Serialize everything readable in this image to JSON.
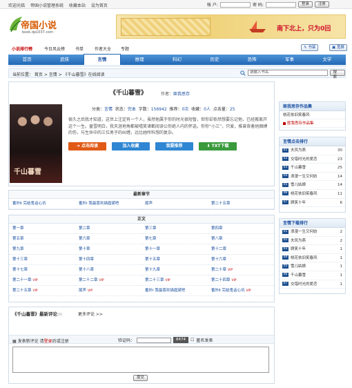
{
  "topbar": {
    "links": [
      "欢迎光临",
      "帝国小说管理系统",
      "收藏本站",
      "设为首页"
    ],
    "user_label": "帐 户:",
    "pass_label": "密 码:",
    "login_btn": "登录",
    "register_btn": "注册"
  },
  "logo": {
    "name": "帝国小说",
    "domain": "book.dp1037.com"
  },
  "banner": {
    "text": "南下北上，只为0回"
  },
  "subnav": {
    "items": [
      "小说排行榜",
      "今日风云榜",
      "书单",
      "作者大全",
      "专题"
    ],
    "bookshelf": "书架",
    "fullscreen": "宽屏"
  },
  "mainnav": [
    "首页",
    "武侠",
    "言情",
    "推理",
    "科幻",
    "历史",
    "恐怖",
    "军事",
    "文学"
  ],
  "mainnav_active": 2,
  "breadcrumb": "当前位置： 首页 > 言情 > 《千山暮雪》在线阅读",
  "search": {
    "placeholder": "请输入书名",
    "button": "搜 索"
  },
  "book": {
    "title": "《千山暮雪》",
    "author_label": "作者：",
    "author": "匪我思存",
    "stats": {
      "category_label": "分类：",
      "category": "言情",
      "status_label": "状态：",
      "status": "完本",
      "words_label": "字数：",
      "words": "156942",
      "recommend_label": "推荐：",
      "recommend": "0次",
      "collect_label": "收藏：",
      "collect": "0人",
      "hits_label": "点击量：",
      "hits": "25"
    },
    "intro": "很久之后我才知道，这世上注定有一个人，虽然他属于你的时光很短暂，但你却依然想要忘记他，已经搬离开这个一生。童雪明白，我天涯地角都被嘻笑诸都阅读公你绝人内的怀选，你你“小三”，只爱，推曾背着他捆缚的伤，与生命中的三位男子的纠缠，远比她所料想的复杂。",
    "actions": {
      "read": "点击阅读",
      "fav": "加入收藏",
      "recommend": "我要推荐",
      "download": "TXT下载"
    }
  },
  "latest": {
    "title": "最新章节",
    "chapters": [
      "番外Ⅱ 完结鬼话心讯",
      "番外Ⅰ 我最喜欢描眉黛吧",
      "尾声",
      "第二十五章"
    ]
  },
  "main_text": {
    "title": "正文",
    "chapters": [
      {
        "t": "第一章",
        "vip": ""
      },
      {
        "t": "第二章",
        "vip": ""
      },
      {
        "t": "第三章",
        "vip": ""
      },
      {
        "t": "第四章",
        "vip": ""
      },
      {
        "t": "第五章",
        "vip": ""
      },
      {
        "t": "第六章",
        "vip": ""
      },
      {
        "t": "第七章",
        "vip": ""
      },
      {
        "t": "第八章",
        "vip": ""
      },
      {
        "t": "第九章",
        "vip": ""
      },
      {
        "t": "第十章",
        "vip": ""
      },
      {
        "t": "第十一章",
        "vip": ""
      },
      {
        "t": "第十二章",
        "vip": ""
      },
      {
        "t": "第十三章",
        "vip": ""
      },
      {
        "t": "第十四章",
        "vip": ""
      },
      {
        "t": "第十五章",
        "vip": ""
      },
      {
        "t": "第十六章",
        "vip": ""
      },
      {
        "t": "第十七章",
        "vip": ""
      },
      {
        "t": "第十八章",
        "vip": ""
      },
      {
        "t": "第十九章",
        "vip": ""
      },
      {
        "t": "第二十章",
        "vip": "VIP"
      },
      {
        "t": "第二十一章",
        "vip": "VIP"
      },
      {
        "t": "第二十二章",
        "vip": "VIP"
      },
      {
        "t": "第二十三章",
        "vip": "VIP"
      },
      {
        "t": "第二十四章",
        "vip": "VIP"
      },
      {
        "t": "第二十五章",
        "vip": "VIP"
      },
      {
        "t": "尾声",
        "vip": "VIP"
      },
      {
        "t": "番外Ⅰ 我最喜欢描眉黛吧",
        "vip": ""
      },
      {
        "t": "番外Ⅱ 完结鬼话心讯",
        "vip": "VIP"
      }
    ]
  },
  "comments": {
    "title": "《千山暮雪》最新评论",
    "count": "(0)",
    "more": "更多评论 >>",
    "post_label": "发表新评论",
    "login_hint_pre": "请",
    "login_link": "登录",
    "login_hint_post": "后或注册",
    "code_label": "验证码：",
    "code_value": "8474",
    "anon_label": "匿名发表",
    "submit": "提交"
  },
  "right": {
    "author_box": {
      "title": "匪我思存作品集",
      "items": [
        {
          "t": "桃花依旧笑春风",
          "red": false
        },
        {
          "t": "匪我思存作品集",
          "red": true
        }
      ]
    },
    "hot": {
      "title": "言情点击排行",
      "items": [
        {
          "n": "01",
          "t": "夫凤为燕",
          "v": "30"
        },
        {
          "n": "02",
          "t": "交错时光的爱恋",
          "v": "23"
        },
        {
          "n": "03",
          "t": "千山暮雪",
          "v": "25"
        },
        {
          "n": "04",
          "t": "浪漫一生又何妨",
          "v": "14"
        },
        {
          "n": "05",
          "t": "雪儿姑娘",
          "v": "14"
        },
        {
          "n": "06",
          "t": "桃花依旧笑春风",
          "v": "11"
        },
        {
          "n": "07",
          "t": "顾笑十年",
          "v": "6"
        }
      ]
    },
    "download": {
      "title": "言情下载排行",
      "items": [
        {
          "n": "01",
          "t": "浪漫一生又何妨",
          "v": "2"
        },
        {
          "n": "02",
          "t": "夫凤为燕",
          "v": "2"
        },
        {
          "n": "03",
          "t": "顾笑十年",
          "v": "1"
        },
        {
          "n": "04",
          "t": "桃花依旧笑春风",
          "v": "1"
        },
        {
          "n": "05",
          "t": "雪儿姑娘",
          "v": "1"
        },
        {
          "n": "06",
          "t": "千山暮雪",
          "v": "1"
        },
        {
          "n": "07",
          "t": "交错时光的爱恋",
          "v": "1"
        }
      ]
    }
  }
}
